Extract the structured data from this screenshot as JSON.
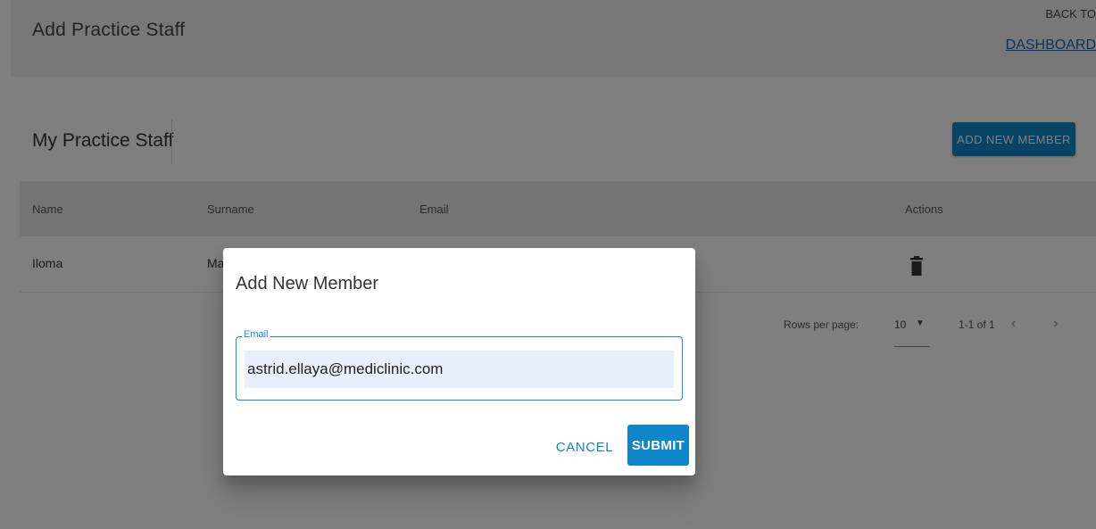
{
  "header": {
    "title": "Add Practice Staff",
    "back_to": "BACK TO",
    "dashboard": "DASHBOARD"
  },
  "section": {
    "title": "My Practice Staff",
    "add_button": "ADD NEW MEMBER"
  },
  "table": {
    "columns": [
      "Name",
      "Surname",
      "Email",
      "Actions"
    ],
    "rows": [
      {
        "name": "Iloma",
        "surname": "Ma",
        "email": "",
        "action_icon": "trash-icon"
      }
    ]
  },
  "pagination": {
    "rows_per_page_label": "Rows per page:",
    "rows_per_page": "10",
    "range": "1-1 of 1",
    "prev": "‹",
    "next": "›"
  },
  "dialog": {
    "title": "Add New Member",
    "email_label": "Email",
    "email_value": "astrid.ellaya@mediclinic.com",
    "cancel": "CANCEL",
    "submit": "SUBMIT"
  },
  "colors": {
    "primary": "#0f86c9",
    "field_focus": "#1e88e5",
    "link": "#1565c0"
  }
}
